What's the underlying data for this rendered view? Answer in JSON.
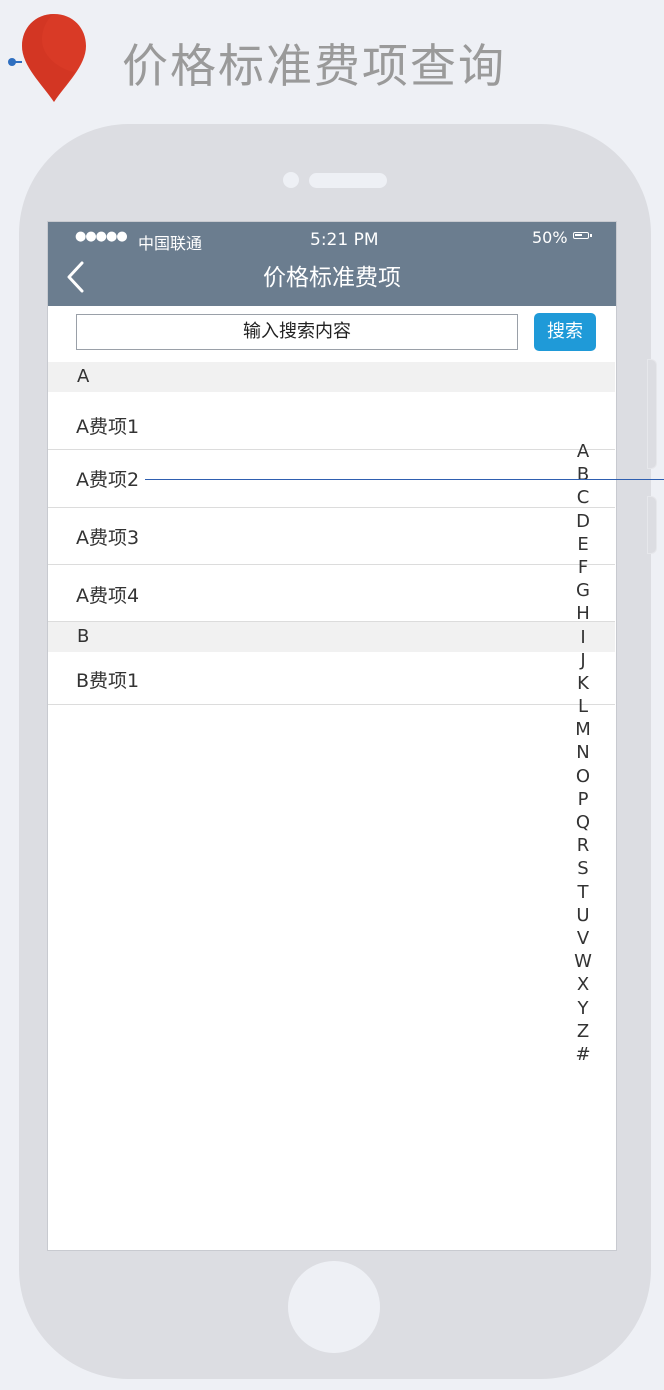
{
  "page": {
    "title": "价格标准费项查询"
  },
  "status_bar": {
    "signal": "●●●●●",
    "carrier": "中国联通",
    "time": "5:21 PM",
    "battery": "50%"
  },
  "nav": {
    "title": "价格标准费项"
  },
  "search": {
    "placeholder": "输入搜索内容",
    "button_label": "搜索"
  },
  "sections": [
    {
      "letter": "A",
      "items": [
        "A费项1",
        "A费项2",
        "A费项3",
        "A费项4"
      ]
    },
    {
      "letter": "B",
      "items": [
        "B费项1"
      ]
    }
  ],
  "index_letters": [
    "A",
    "B",
    "C",
    "D",
    "E",
    "F",
    "G",
    "H",
    "I",
    "J",
    "K",
    "L",
    "M",
    "N",
    "O",
    "P",
    "Q",
    "R",
    "S",
    "T",
    "U",
    "V",
    "W",
    "X",
    "Y",
    "Z",
    "#"
  ],
  "colors": {
    "navbar": "#6b7d8f",
    "accent": "#1f9ad8",
    "pin": "#d93a26",
    "annotation": "#2f5fb0"
  }
}
